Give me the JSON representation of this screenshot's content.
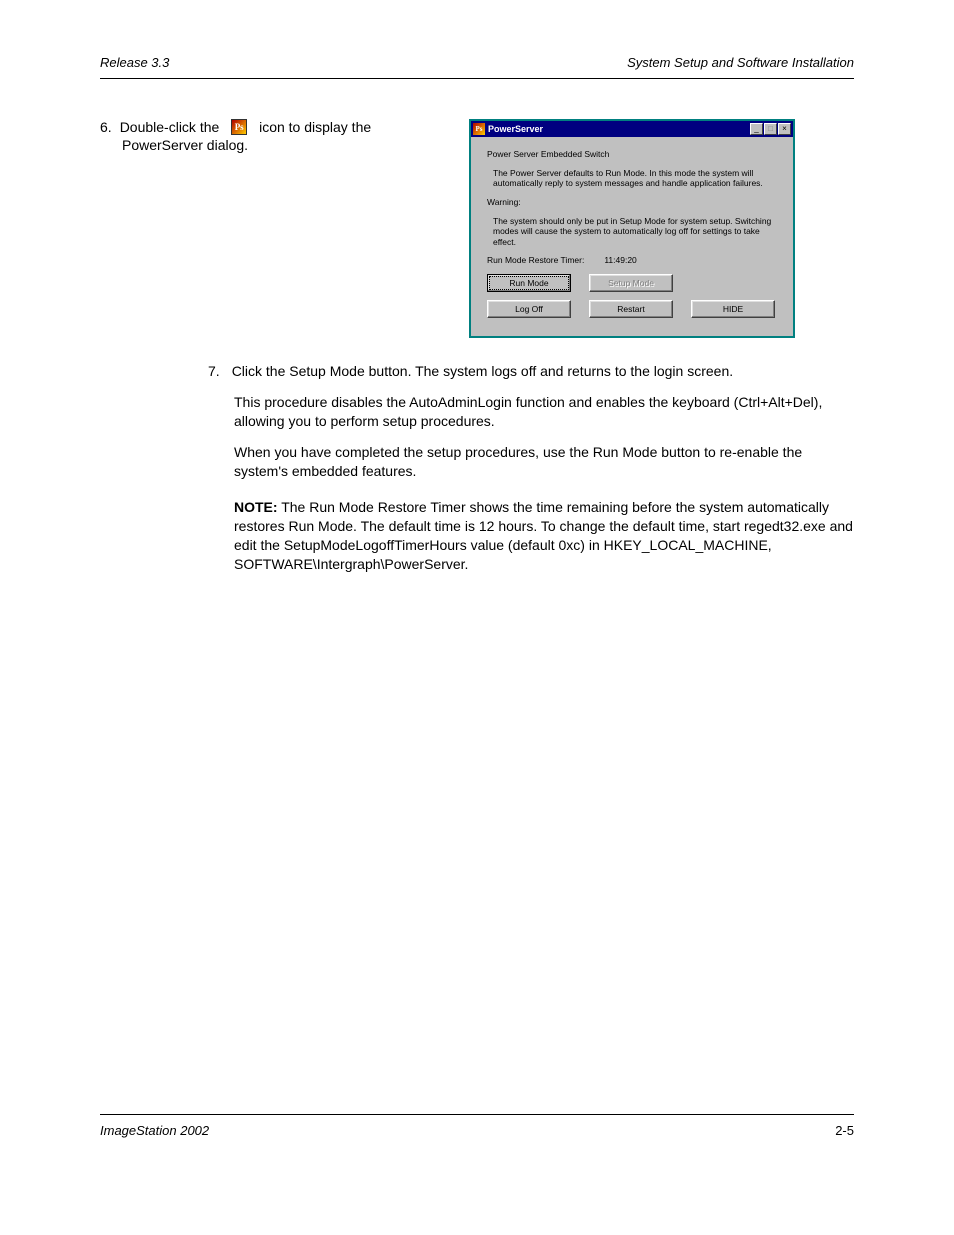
{
  "header": {
    "left": "Release 3.3",
    "right": "System Setup and Software Installation"
  },
  "step": {
    "number": "6.",
    "text_prefix": "Double-click the ",
    "icon_name": "ps-icon",
    "text_suffix": " icon to display the",
    "line2": "PowerServer dialog."
  },
  "dialog": {
    "title": "PowerServer",
    "section1_title": "Power Server Embedded Switch",
    "section1_body": "The Power Server defaults to Run Mode. In this mode the system will automatically reply to system messages and handle application failures.",
    "warning_title": "Warning:",
    "warning_body": "The system should only be put in Setup Mode for system setup. Switching modes will cause the system to automatically log off for settings to take effect.",
    "timer_label": "Run Mode Restore Timer:",
    "timer_value": "11:49:20",
    "buttons": {
      "run_mode": "Run Mode",
      "setup_mode": "Setup Mode",
      "log_off": "Log Off",
      "restart": "Restart",
      "hide": "HIDE"
    }
  },
  "paragraphs": {
    "p1_step": "7.",
    "p1": "Click the Setup Mode button. The system logs off and returns to the login screen.",
    "p2": "This procedure disables the AutoAdminLogin function and enables the keyboard (Ctrl+Alt+Del), allowing you to perform setup procedures.",
    "p3": "When you have completed the setup procedures, use the Run Mode button to re-enable the system's embedded features.",
    "note_label": "NOTE:",
    "note_body": "The Run Mode Restore Timer shows the time remaining before the system automatically restores Run Mode. The default time is 12 hours. To change the default time, start regedt32.exe and edit the SetupModeLogoffTimerHours value (default 0xc) in HKEY_LOCAL_MACHINE, SOFTWARE\\Intergraph\\PowerServer."
  },
  "footer": {
    "left": "ImageStation 2002",
    "right": "2-5"
  }
}
